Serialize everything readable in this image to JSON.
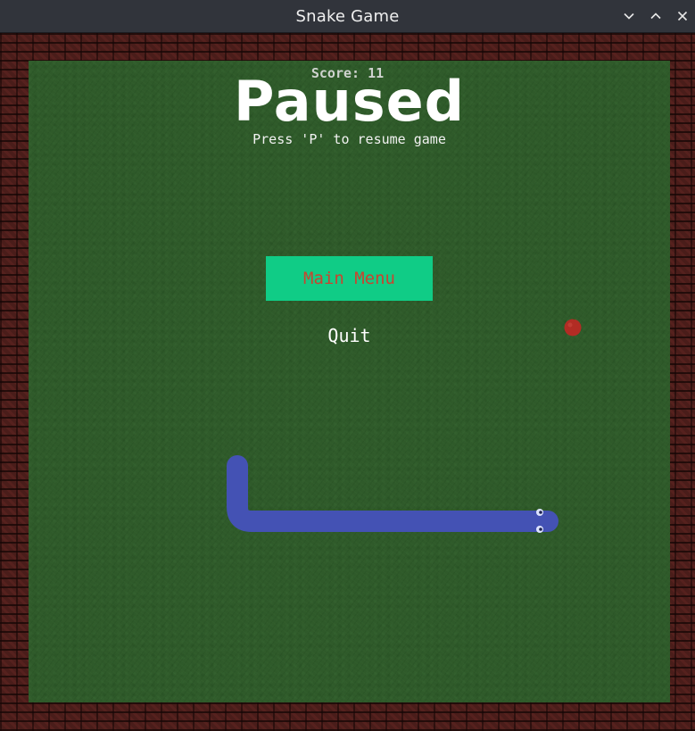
{
  "window": {
    "title": "Snake Game",
    "controls": {
      "minimize": "chevron-down-icon",
      "maximize": "chevron-up-icon",
      "close": "close-icon"
    }
  },
  "hud": {
    "score_label": "Score: 11"
  },
  "pause_overlay": {
    "heading": "Paused",
    "hint": "Press 'P' to resume game",
    "main_menu_label": "Main Menu",
    "quit_label": "Quit"
  },
  "colors": {
    "field": "#2f5a2a",
    "wall": "#4a1d1a",
    "snake": "#4452b4",
    "apple": "#b22c24",
    "menu_button_bg": "#10cc86",
    "menu_button_text": "#c8452f"
  }
}
